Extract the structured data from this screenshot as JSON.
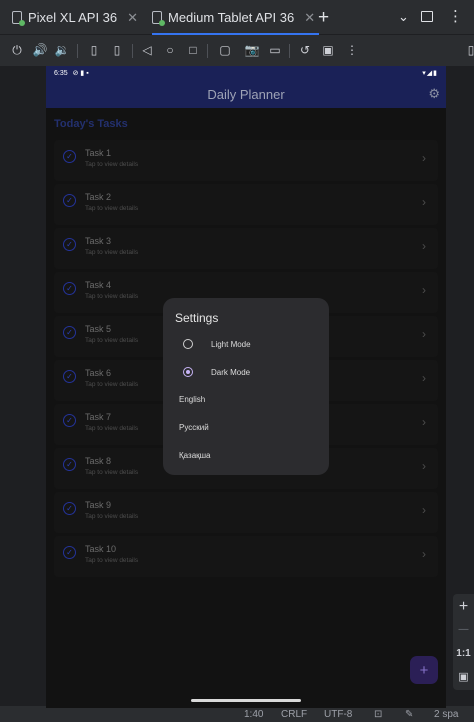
{
  "tabs": [
    {
      "label": "Pixel XL API 36",
      "active": false
    },
    {
      "label": "Medium Tablet API 36",
      "active": true
    }
  ],
  "toolbar_icons": [
    "power-icon",
    "volume-up-icon",
    "volume-down-icon",
    "rotate-left-icon",
    "rotate-right-icon",
    "back-icon",
    "home-icon",
    "overview-icon",
    "fold-icon",
    "screenshot-icon",
    "record-icon",
    "reset-icon",
    "snapshot-icon",
    "more-icon"
  ],
  "device": {
    "status_time": "6:35",
    "status_right": "▾◢▮",
    "app_title": "Daily Planner",
    "section_title": "Today's Tasks",
    "tasks": [
      {
        "name": "Task 1",
        "sub": "Tap to view details"
      },
      {
        "name": "Task 2",
        "sub": "Tap to view details"
      },
      {
        "name": "Task 3",
        "sub": "Tap to view details"
      },
      {
        "name": "Task 4",
        "sub": "Tap to view details"
      },
      {
        "name": "Task 5",
        "sub": "Tap to view details"
      },
      {
        "name": "Task 6",
        "sub": "Tap to view details"
      },
      {
        "name": "Task 7",
        "sub": "Tap to view details"
      },
      {
        "name": "Task 8",
        "sub": "Tap to view details"
      },
      {
        "name": "Task 9",
        "sub": "Tap to view details"
      },
      {
        "name": "Task 10",
        "sub": "Tap to view details"
      }
    ],
    "fab_label": "+"
  },
  "dialog": {
    "title": "Settings",
    "themes": [
      {
        "label": "Light Mode",
        "selected": false
      },
      {
        "label": "Dark Mode",
        "selected": true
      }
    ],
    "languages": [
      "English",
      "Русский",
      "Қазақша"
    ]
  },
  "side_panel": {
    "zoom_in": "+",
    "zoom_out": "—",
    "ratio": "1:1"
  },
  "ide_status": {
    "position": "1:40",
    "line_sep": "CRLF",
    "encoding": "UTF-8",
    "indent": "2 spa"
  },
  "colors": {
    "accent": "#3574f0",
    "app_bar": "#1a2157",
    "dialog_bg": "#2c2c2f",
    "radio_selected": "#c7b4f5"
  }
}
